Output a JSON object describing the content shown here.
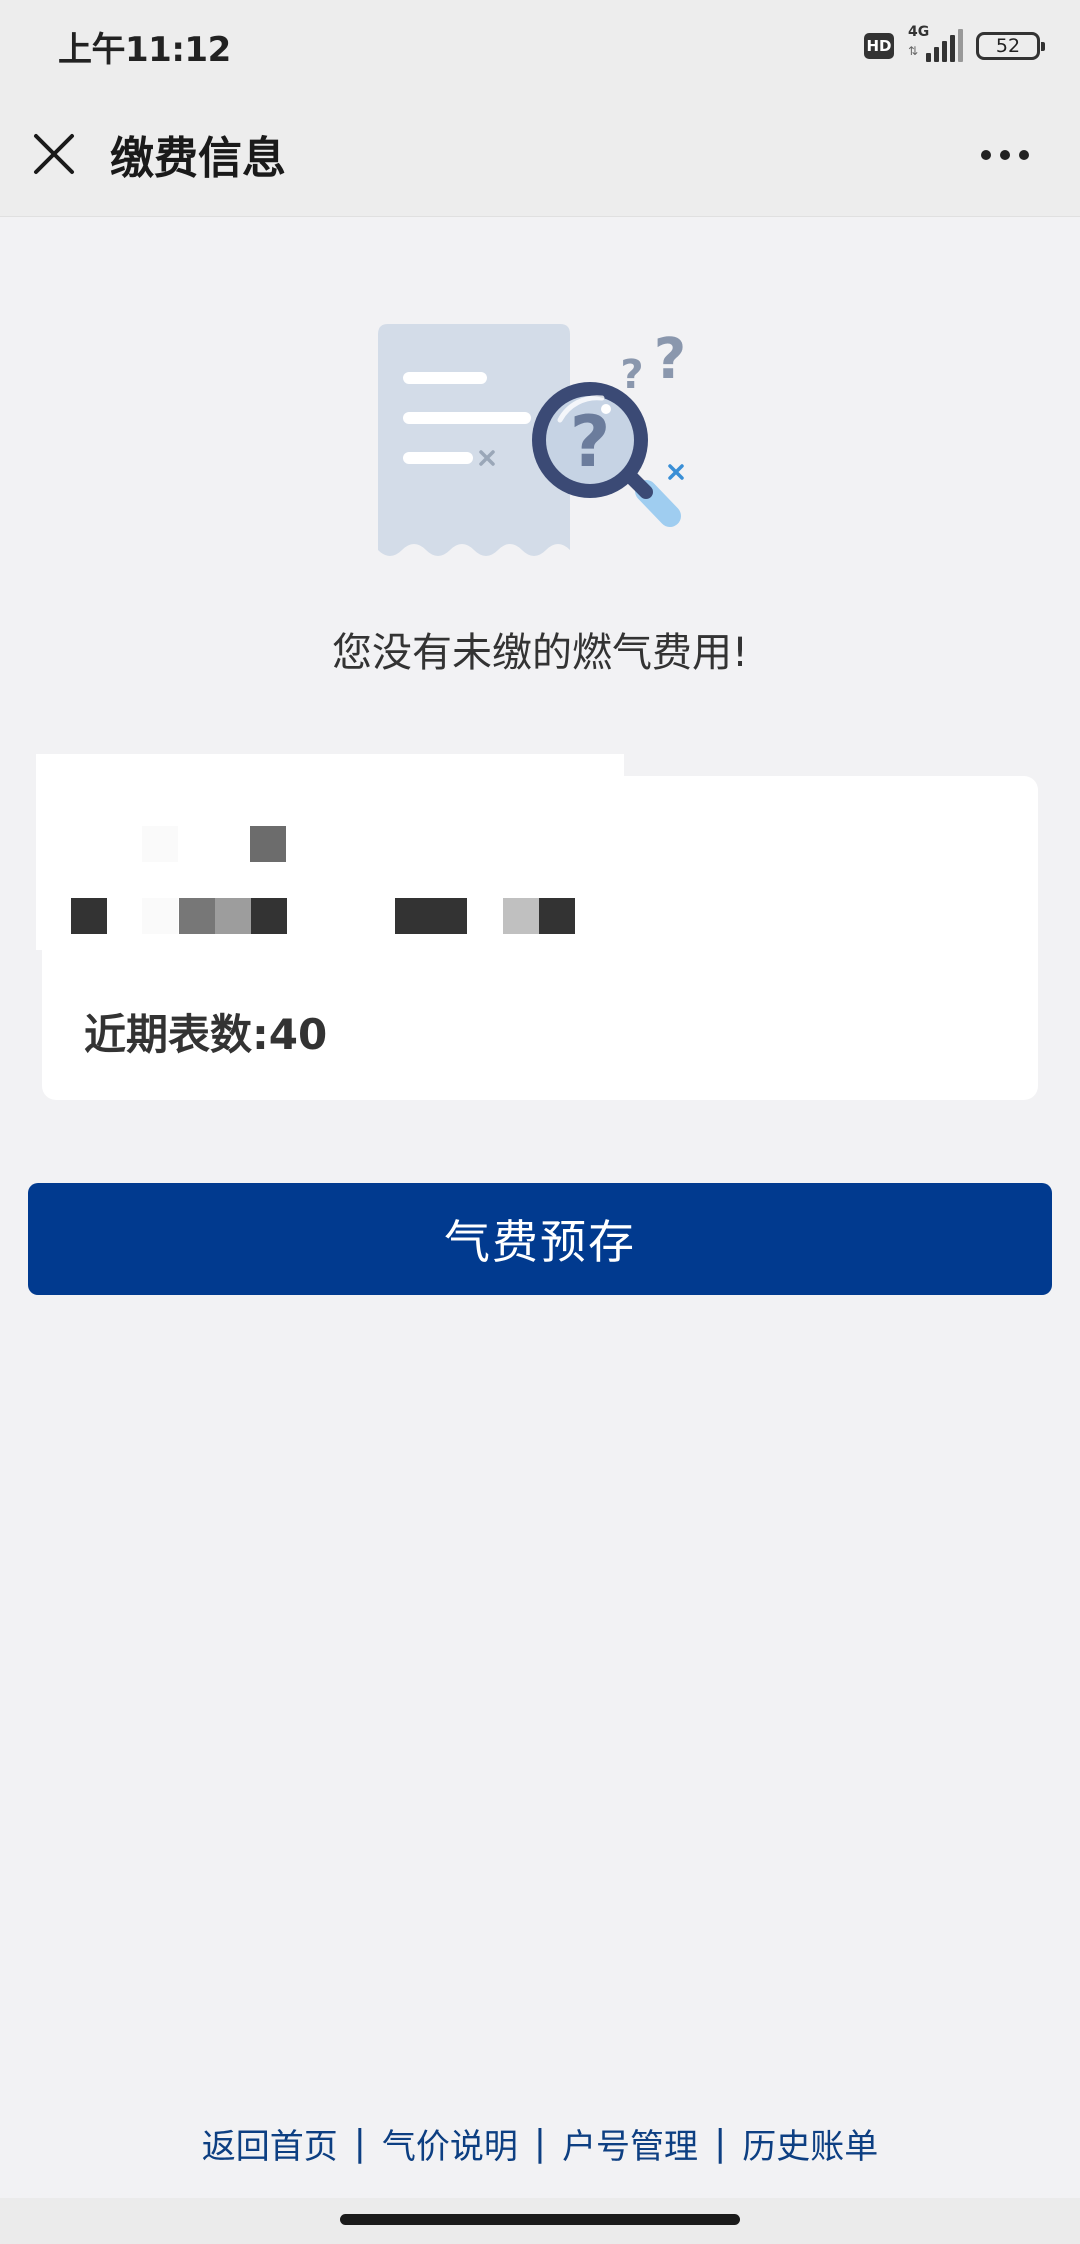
{
  "status_bar": {
    "time": "上午11:12",
    "hd_label": "HD",
    "network_label": "4G",
    "network_arrows": "⇅",
    "battery_level": "52"
  },
  "nav": {
    "title": "缴费信息",
    "close_icon": "close-icon",
    "more_icon": "more-dots-icon"
  },
  "empty_state": {
    "illustration": "receipt-magnifier-question-illustration",
    "message": "您没有未缴的燃气费用!"
  },
  "card": {
    "reading_label": "近期表数:40"
  },
  "actions": {
    "prepay_label": "气费预存"
  },
  "footer": {
    "links": [
      "返回首页",
      "气价说明",
      "户号管理",
      "历史账单"
    ],
    "separator": "|"
  },
  "colors": {
    "primary_button": "#013a8f",
    "footer_link": "#0d3f82",
    "background": "#f2f2f4"
  }
}
